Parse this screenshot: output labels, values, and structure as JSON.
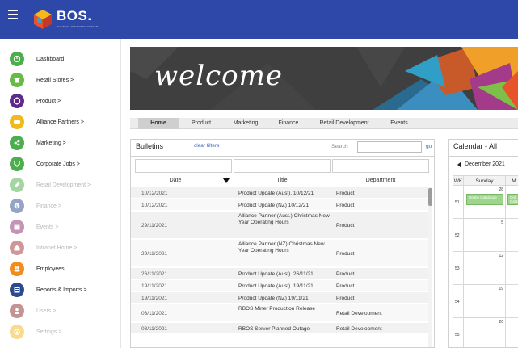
{
  "app": {
    "logo_text": "BOS.",
    "logo_subtitle": "BUSINESS OPERATING SYSTEM"
  },
  "sidebar": {
    "items": [
      {
        "label": "Dashboard",
        "icon": "dashboard-icon",
        "color": "#4cae4c",
        "enabled": true
      },
      {
        "label": "Retail Stores >",
        "icon": "store-icon",
        "color": "#66bb44",
        "enabled": true
      },
      {
        "label": "Product >",
        "icon": "product-icon",
        "color": "#5e2a8c",
        "enabled": true
      },
      {
        "label": "Alliance Partners >",
        "icon": "partners-icon",
        "color": "#f2b81c",
        "enabled": true
      },
      {
        "label": "Marketing >",
        "icon": "marketing-icon",
        "color": "#4cae4c",
        "enabled": true
      },
      {
        "label": "Corporate Jobs >",
        "icon": "jobs-icon",
        "color": "#4cae4c",
        "enabled": true
      },
      {
        "label": "Retail Development >",
        "icon": "development-icon",
        "color": "#4cae4c",
        "enabled": false
      },
      {
        "label": "Finance >",
        "icon": "finance-icon",
        "color": "#2e4a8e",
        "enabled": false
      },
      {
        "label": "Events >",
        "icon": "events-icon",
        "color": "#8a2a6e",
        "enabled": false
      },
      {
        "label": "Intranet Home >",
        "icon": "intranet-icon",
        "color": "#a03232",
        "enabled": false
      },
      {
        "label": "Employees",
        "icon": "employees-icon",
        "color": "#f28c1c",
        "enabled": true
      },
      {
        "label": "Reports & Imports >",
        "icon": "reports-icon",
        "color": "#2e4a8e",
        "enabled": true
      },
      {
        "label": "Users >",
        "icon": "users-icon",
        "color": "#8a2a2a",
        "enabled": false
      },
      {
        "label": "Settings >",
        "icon": "settings-icon",
        "color": "#f2b81c",
        "enabled": false
      }
    ]
  },
  "banner": {
    "welcome": "welcome"
  },
  "tabs": [
    {
      "label": "Home",
      "active": true
    },
    {
      "label": "Product",
      "active": false
    },
    {
      "label": "Marketing",
      "active": false
    },
    {
      "label": "Finance",
      "active": false
    },
    {
      "label": "Retail Development",
      "active": false
    },
    {
      "label": "Events",
      "active": false
    }
  ],
  "bulletins": {
    "title": "Bulletins",
    "clear_filters": "clear filters",
    "search_label": "Search",
    "go": "go",
    "columns": [
      "Date",
      "Title",
      "Department"
    ],
    "rows": [
      {
        "date": "10/12/2021",
        "title": "Product Update (Aust). 10/12/21",
        "dept": "Product"
      },
      {
        "date": "10/12/2021",
        "title": "Product Update (NZ) 10/12/21",
        "dept": "Product"
      },
      {
        "date": "29/11/2021",
        "title": "Alliance Partner (Aust.) Christmas New Year Operating Hours",
        "dept": "Product"
      },
      {
        "date": "29/11/2021",
        "title": "Alliance Partner (NZ) Christmas New Year Operating Hours",
        "dept": "Product"
      },
      {
        "date": "26/11/2021",
        "title": "Product Update (Aust). 26/11/21",
        "dept": "Product"
      },
      {
        "date": "19/11/2021",
        "title": "Product Update (Aust). 19/11/21",
        "dept": "Product"
      },
      {
        "date": "19/11/2021",
        "title": "Product Update (NZ) 19/11/21",
        "dept": "Product"
      },
      {
        "date": "03/11/2021",
        "title": "RBOS Miner Production Release",
        "dept": "Retail Development"
      },
      {
        "date": "03/11/2021",
        "title": "RBOS Server Planned Outage",
        "dept": "Retail Development"
      }
    ]
  },
  "calendar": {
    "title": "Calendar - All",
    "month": "December 2021",
    "wk_label": "WK",
    "day_label": "Sunday",
    "next_day_initial": "M",
    "weeks": [
      {
        "wk": "51",
        "day": "28",
        "event": "Online Catalogue",
        "event2": "Onli Cata"
      },
      {
        "wk": "52",
        "day": "5",
        "event": "",
        "event2": ""
      },
      {
        "wk": "53",
        "day": "12",
        "event": "",
        "event2": ""
      },
      {
        "wk": "54",
        "day": "19",
        "event": "",
        "event2": ""
      },
      {
        "wk": "55",
        "day": "26",
        "event": "",
        "event2": ""
      }
    ],
    "event_color": "#9dd68a"
  },
  "colors": {
    "topbar": "#2d48a8",
    "link": "#3a66c8"
  }
}
